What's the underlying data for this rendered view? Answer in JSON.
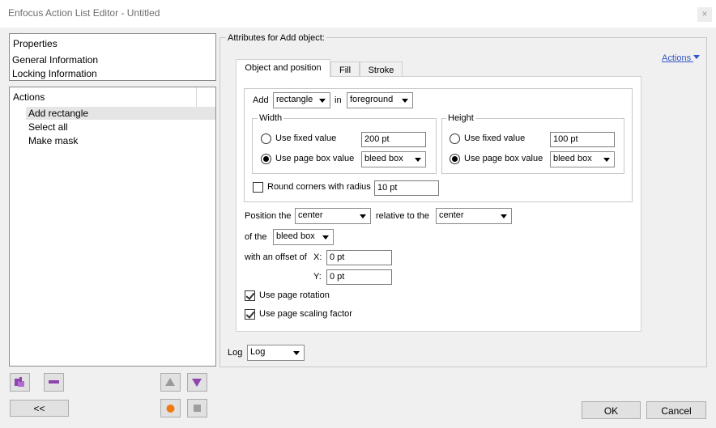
{
  "window": {
    "title": "Enfocus Action List Editor - Untitled",
    "close_glyph": "×"
  },
  "sidebar": {
    "top_items": [
      "Properties",
      "General Information",
      "Locking Information"
    ],
    "actions_header": "Actions",
    "actions": [
      "Add rectangle",
      "Select all",
      "Make mask"
    ],
    "back_button": "<<"
  },
  "main": {
    "heading": "Attributes for Add object:",
    "actions_link": "Actions",
    "tabs": [
      "Object and position",
      "Fill",
      "Stroke"
    ],
    "add": {
      "label": "Add",
      "shape": "rectangle",
      "in_label": "in",
      "layer": "foreground"
    },
    "width": {
      "legend": "Width",
      "fixed_label": "Use fixed value",
      "fixed_value": "200 pt",
      "fixed_selected": false,
      "page_label": "Use page box value",
      "page_value": "bleed box",
      "page_selected": true
    },
    "height": {
      "legend": "Height",
      "fixed_label": "Use fixed value",
      "fixed_value": "100 pt",
      "fixed_selected": false,
      "page_label": "Use page box value",
      "page_value": "bleed box",
      "page_selected": true
    },
    "round_corners": {
      "label": "Round corners with radius",
      "value": "10 pt",
      "checked": false
    },
    "position": {
      "label": "Position the",
      "value": "center",
      "relative_label": "relative to the",
      "relative_value": "center",
      "of_label": "of the",
      "of_value": "bleed box",
      "offset_label": "with an offset of",
      "x_label": "X:",
      "x_value": "0 pt",
      "y_label": "Y:",
      "y_value": "0 pt"
    },
    "use_page_rotation": {
      "label": "Use page rotation",
      "checked": true
    },
    "use_page_scaling": {
      "label": "Use page scaling factor",
      "checked": true
    },
    "log": {
      "label": "Log",
      "value": "Log"
    }
  },
  "footer": {
    "ok": "OK",
    "cancel": "Cancel"
  },
  "colors": {
    "accent_link": "#3355cc",
    "purple_icon": "#8e44ad",
    "orange_icon": "#f07a10"
  }
}
